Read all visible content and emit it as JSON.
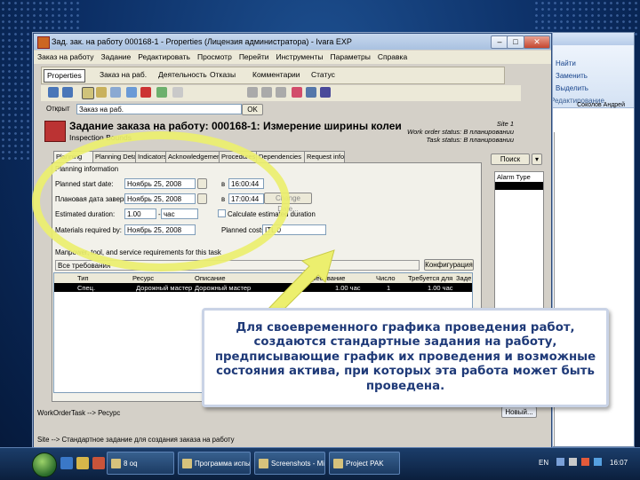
{
  "window": {
    "title": "Зад. зак. на работу 000168-1 - Properties (Лицензия администратора) - Ivara EXP",
    "controls": {
      "minimize": "–",
      "maximize": "□",
      "close": "✕"
    }
  },
  "menu": [
    "Заказ на работу",
    "Задание",
    "Редактировать",
    "Просмотр",
    "Перейти",
    "Инструменты",
    "Параметры",
    "Справка"
  ],
  "toolbar": {
    "properties": "Properties",
    "order": "Заказ на раб.",
    "activity": "Деятельность",
    "failures": "Отказы",
    "comments": "Комментарии",
    "status": "Статус"
  },
  "open_bar": {
    "label": "Открыт",
    "value": "Заказ на раб.",
    "ok": "OK"
  },
  "header": {
    "title": "Задание заказа на работу: 000168-1: Измерение ширины колеи",
    "subtitle": "Inspection Bounds",
    "site": "Site 1",
    "wo_status": "Work order status: В планировании",
    "task_status": "Task status: В планировании"
  },
  "tabs": [
    "Planning",
    "Planning Details",
    "Indicators",
    "Acknowledgements",
    "Procedures",
    "Dependencies",
    "Request info"
  ],
  "planning": {
    "section": "Planning information",
    "start_label": "Planned start date:",
    "start_date": "Ноябрь 25, 2008",
    "start_time": "16:00:44",
    "end_label": "Плановая дата завершения",
    "end_date": "Ноябрь 25, 2008",
    "end_time": "17:00:44",
    "at": "в",
    "change_date": "Change Date...",
    "duration_label": "Estimated duration:",
    "duration_value": "1.00",
    "duration_unit": "час",
    "calc_label": "Calculate estimated duration",
    "materials_label": "Materials required by:",
    "materials_date": "Ноябрь 25, 2008",
    "cost_label": "Planned costs:",
    "cost_value": "ITL 0",
    "req_caption": "Manpower, tool, and service requirements for this task",
    "all_req": "Все требования",
    "config": "Конфигурация"
  },
  "grid": {
    "headers": [
      "Тип",
      "Ресурс",
      "Описание",
      "Требование",
      "Число",
      "Требуется для",
      "Задe"
    ],
    "rows": [
      [
        "Спец.",
        "Дорожный мастер",
        "Дорожный мастер",
        "1.00 час",
        "1",
        "1.00 час"
      ]
    ]
  },
  "right": {
    "search": "Поиск",
    "col": "Alarm Type",
    "new_btn": "Новый..."
  },
  "status_inner": "WorkOrderTask --> Ресурс",
  "status_outer": "Site --> Стандартное задание для создания заказа на работу",
  "bg_word": {
    "find": "Найти",
    "replace": "Заменить",
    "select": "Выделить",
    "group": "Редактирование",
    "header_name": "Соколов Андрей"
  },
  "callout": "Для своевременного графика проведения работ, создаются стандартные задания на работу, предписывающие график их проведения и возможные состояния актива, при которых эта работа может быть проведена.",
  "taskbar": {
    "items": [
      "8 oq",
      "Программа испыт...",
      "Screenshots - Micro...",
      "Project PAK"
    ],
    "lang": "EN",
    "time": "16:07"
  },
  "colors": {
    "highlight": "#ecef6e",
    "callout_text": "#1f3a78",
    "grid_selected": "#000000"
  }
}
